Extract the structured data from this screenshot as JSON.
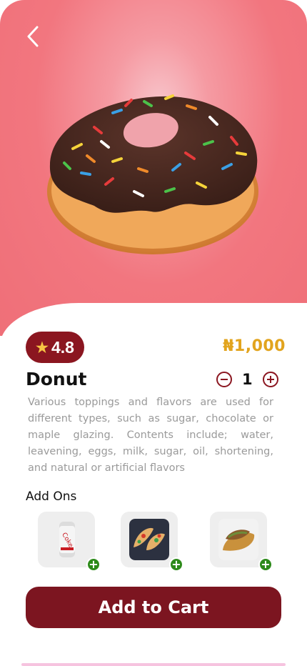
{
  "header": {
    "back_icon": "chevron-left-icon"
  },
  "product": {
    "name": "Donut",
    "rating": "4.8",
    "price": "₦1,000",
    "description": "Various toppings and flavors are used for different types, such as sugar, chocolate or maple glazing. Contents include; water, leavening, eggs, milk, sugar, oil, shortening, and natural or artificial flavors",
    "quantity": "1"
  },
  "addons": {
    "title": "Add Ons",
    "items": [
      {
        "icon": "soda-can-icon"
      },
      {
        "icon": "tacos-icon"
      },
      {
        "icon": "pastry-icon"
      }
    ]
  },
  "cart": {
    "label": "Add to Cart"
  },
  "colors": {
    "accent": "#8b1620",
    "price": "#e2a41e",
    "hero": "#f2767f",
    "add": "#2d8a1a"
  }
}
